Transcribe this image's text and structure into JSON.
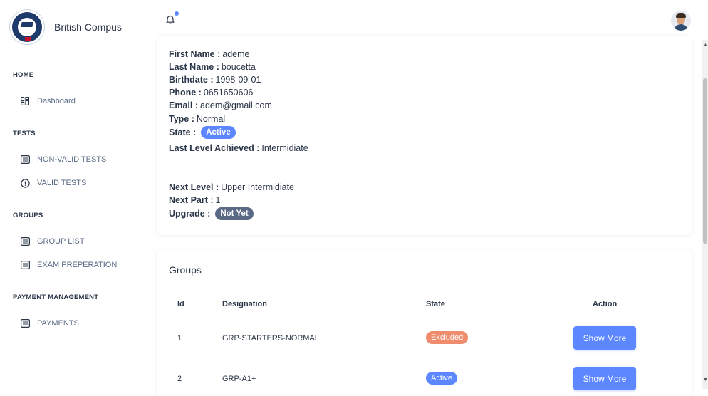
{
  "brand": {
    "name": "British Compus"
  },
  "sidebar": {
    "sections": [
      {
        "title": "HOME",
        "items": [
          {
            "label": "Dashboard",
            "icon": "dashboard-icon"
          }
        ]
      },
      {
        "title": "TESTS",
        "items": [
          {
            "label": "NON-VALID TESTS",
            "icon": "list-icon"
          },
          {
            "label": "VALID TESTS",
            "icon": "alert-circle-icon"
          }
        ]
      },
      {
        "title": "GROUPS",
        "items": [
          {
            "label": "GROUP LIST",
            "icon": "list-icon"
          },
          {
            "label": "EXAM PREPERATION",
            "icon": "list-icon"
          }
        ]
      },
      {
        "title": "PAYMENT MANAGEMENT",
        "items": [
          {
            "label": "PAYMENTS",
            "icon": "list-icon"
          }
        ]
      }
    ]
  },
  "profile": {
    "first_name_label": "First Name :",
    "first_name": "ademe",
    "last_name_label": "Last Name :",
    "last_name": "boucetta",
    "birthdate_label": "Birthdate :",
    "birthdate": "1998-09-01",
    "phone_label": "Phone :",
    "phone": "0651650606",
    "email_label": "Email :",
    "email": "adem@gmail.com",
    "type_label": "Type :",
    "type": "Normal",
    "state_label": "State :",
    "state": "Active",
    "last_level_label": "Last Level Achieved :",
    "last_level": "Intermidiate",
    "next_level_label": "Next Level :",
    "next_level": "Upper Intermidiate",
    "next_part_label": "Next Part :",
    "next_part": "1",
    "upgrade_label": "Upgrade :",
    "upgrade": "Not Yet"
  },
  "groups": {
    "title": "Groups",
    "columns": [
      "Id",
      "Designation",
      "State",
      "Action"
    ],
    "rows": [
      {
        "id": "1",
        "designation": "GRP-STARTERS-NORMAL",
        "state": "Excluded",
        "action": "Show More"
      },
      {
        "id": "2",
        "designation": "GRP-A1+",
        "state": "Active",
        "action": "Show More"
      }
    ]
  },
  "colors": {
    "primary": "#5d87ff",
    "danger": "#f08c6e",
    "slate": "#5a6a85",
    "text": "#2a3547"
  }
}
